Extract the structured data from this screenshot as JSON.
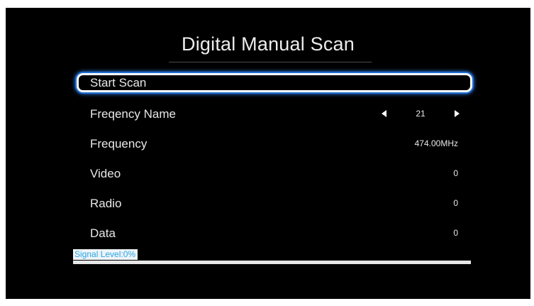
{
  "title": "Digital Manual Scan",
  "menu": {
    "start_scan": "Start Scan",
    "frequency_name": {
      "label": "Freqency Name",
      "value": "21"
    },
    "frequency": {
      "label": "Frequency",
      "value": "474.00MHz"
    },
    "video": {
      "label": "Video",
      "value": "0"
    },
    "radio": {
      "label": "Radio",
      "value": "0"
    },
    "data": {
      "label": "Data",
      "value": "0"
    }
  },
  "signal": {
    "label": "Signal Level:0%",
    "level_percent": 0
  },
  "colors": {
    "background": "#000000",
    "selection_glow": "#2f86ff",
    "signal_text": "#29a8e6"
  },
  "icons": {
    "decrement": "arrow-left-icon",
    "increment": "arrow-right-icon"
  }
}
